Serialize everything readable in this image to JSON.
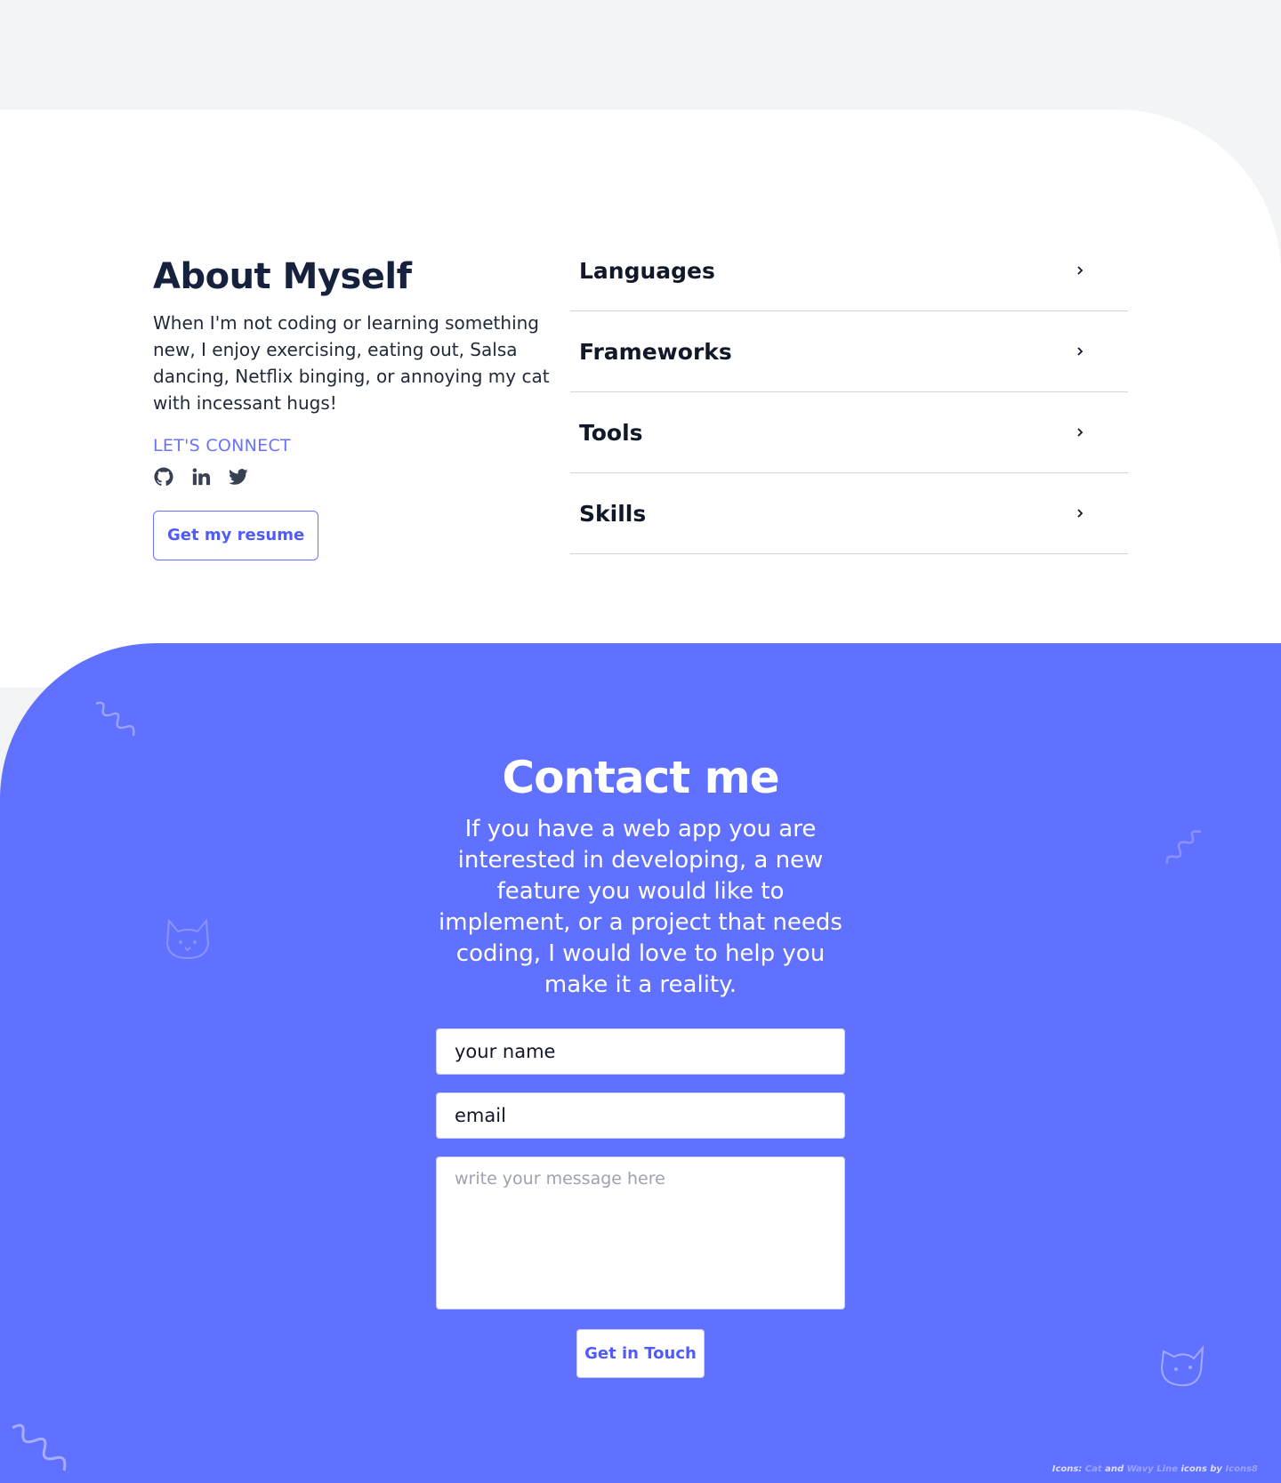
{
  "about": {
    "title": "About Myself",
    "text": "When I'm not coding or learning something new, I enjoy exercising, eating out, Salsa dancing, Netflix binging, or annoying my cat with incessant hugs!",
    "connect_label": "LET'S CONNECT",
    "social": [
      {
        "name": "github",
        "icon": "github-icon"
      },
      {
        "name": "linkedin",
        "icon": "linkedin-icon"
      },
      {
        "name": "twitter",
        "icon": "twitter-icon"
      }
    ],
    "resume_button": "Get my resume"
  },
  "accordion": {
    "items": [
      {
        "label": "Languages"
      },
      {
        "label": "Frameworks"
      },
      {
        "label": "Tools"
      },
      {
        "label": "Skills"
      }
    ]
  },
  "contact": {
    "title": "Contact me",
    "text": "If you have a web app you are interested in developing, a new feature you would like to implement, or a project that needs coding, I would love to help you make it a reality.",
    "name_value": "your name",
    "email_value": "email",
    "message_placeholder": "write your message here",
    "submit_label": "Get in Touch"
  },
  "credits": {
    "prefix": "Icons:",
    "cat": "Cat",
    "and": "and",
    "wavy": "Wavy Line",
    "icons_by": "icons by",
    "author": "Icons8"
  },
  "colors": {
    "accent": "#6171ff",
    "title": "#16213e",
    "background": "#f3f4f6"
  }
}
